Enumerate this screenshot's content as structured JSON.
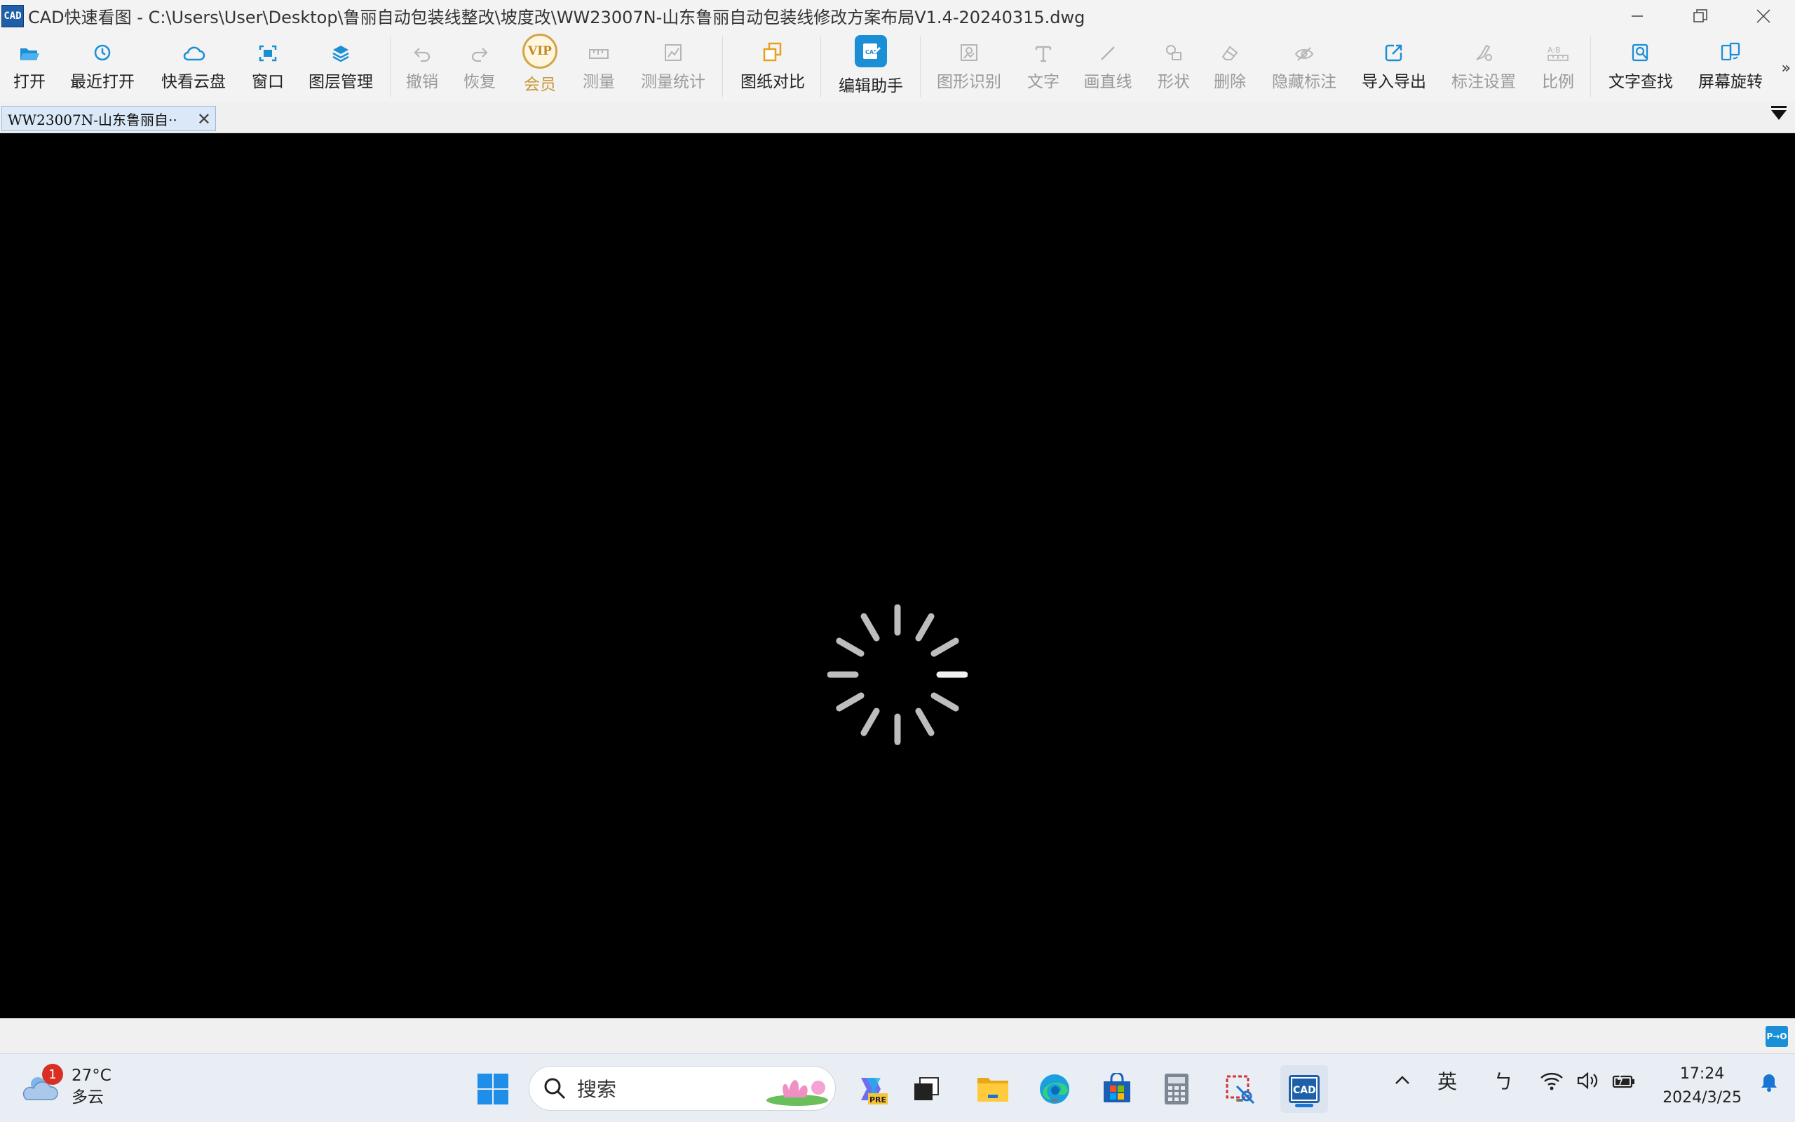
{
  "window": {
    "logo_text": "CAD",
    "title": "CAD快速看图 - C:\\Users\\User\\Desktop\\鲁丽自动包装线整改\\坡度改\\WW23007N-山东鲁丽自动包装线修改方案布局V1.4-20240315.dwg"
  },
  "toolbar": {
    "open": "打开",
    "recent": "最近打开",
    "cloud": "快看云盘",
    "window": "窗口",
    "layers": "图层管理",
    "undo": "撤销",
    "redo": "恢复",
    "vip": "会员",
    "vip_badge": "VIP",
    "measure": "测量",
    "measure_stats": "测量统计",
    "compare": "图纸对比",
    "edit_assistant": "编辑助手",
    "shape_recognize": "图形识别",
    "text": "文字",
    "line": "画直线",
    "shape": "形状",
    "delete": "删除",
    "hide_annotation": "隐藏标注",
    "import_export": "导入导出",
    "annotation_settings": "标注设置",
    "scale": "比例",
    "text_search": "文字查找",
    "screen_rotate": "屏幕旋转",
    "more": "»"
  },
  "tabs": {
    "doc_tab_label": "WW23007N-山东鲁丽自··",
    "close": "✕"
  },
  "statusbar": {
    "mode_button": "P→O"
  },
  "taskbar": {
    "weather_temp": "27°C",
    "weather_desc": "多云",
    "weather_badge": "1",
    "search_placeholder": "搜索",
    "tray_caret": "^",
    "ime_lang": "英",
    "ime_mode": "ㄅ",
    "time": "17:24",
    "date": "2024/3/25"
  }
}
